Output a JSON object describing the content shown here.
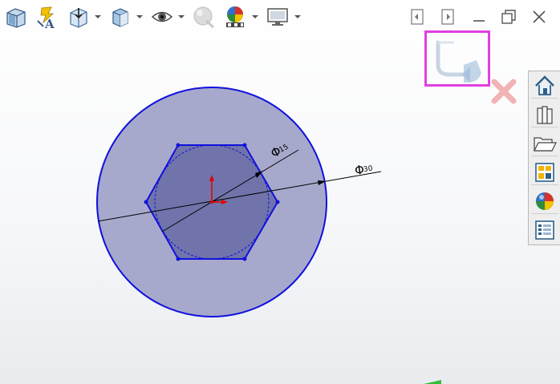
{
  "toolbar": {
    "items": [
      {
        "icon": "section-view-icon",
        "dropdown": false
      },
      {
        "icon": "dynamic-annotation-icon",
        "dropdown": false
      },
      {
        "icon": "view-orientation-icon",
        "dropdown": true
      },
      {
        "icon": "display-style-icon",
        "dropdown": true
      },
      {
        "icon": "hide-show-items-icon",
        "dropdown": true
      },
      {
        "icon": "edit-appearance-icon",
        "dropdown": false
      },
      {
        "icon": "apply-scene-icon",
        "dropdown": true
      },
      {
        "icon": "view-settings-icon",
        "dropdown": true
      }
    ]
  },
  "window_controls": [
    "restore-left-icon",
    "restore-right-icon",
    "minimize-icon",
    "maximize-icon",
    "close-icon"
  ],
  "confirmation": {
    "ok_icon": "confirm-exit-sketch-icon",
    "cancel_icon": "cancel-sketch-icon"
  },
  "task_pane": {
    "items": [
      "solidworks-resources-icon",
      "design-library-icon",
      "file-explorer-icon",
      "view-palette-icon",
      "appearances-scenes-icon",
      "custom-properties-icon"
    ]
  },
  "sketch": {
    "dimensions": [
      {
        "symbol": "Φ",
        "value": "15"
      },
      {
        "symbol": "Φ",
        "value": "30"
      }
    ],
    "colors": {
      "outer_fill": "#a7a9cc",
      "inner_fill": "#7074aa",
      "edge": "#1111dd",
      "origin": "#e00000"
    }
  }
}
